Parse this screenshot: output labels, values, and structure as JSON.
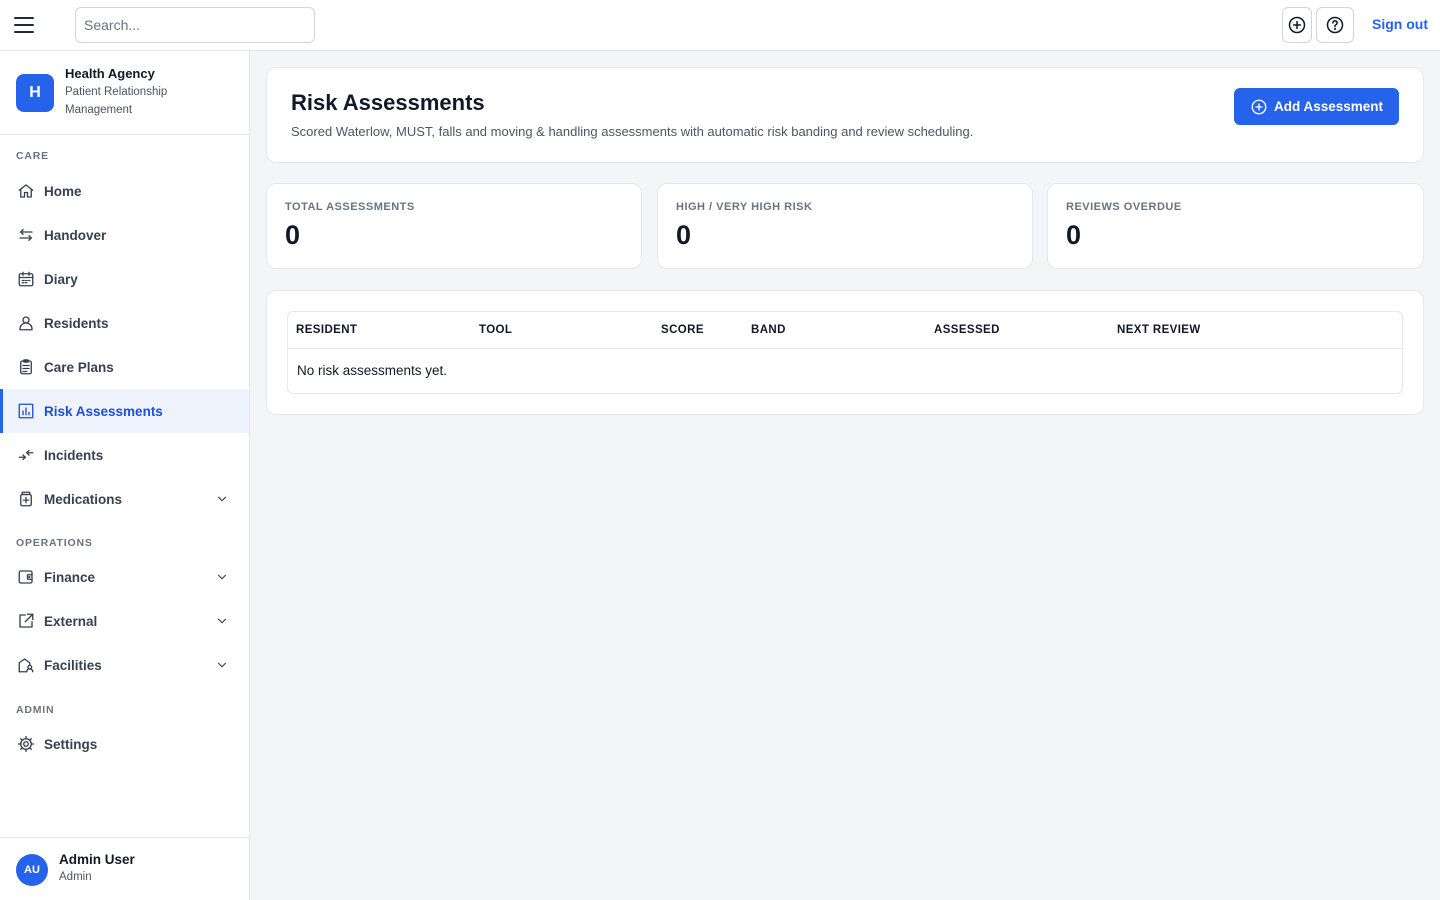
{
  "topbar": {
    "search_placeholder": "Search...",
    "sign_out": "Sign out"
  },
  "brand": {
    "logo_letter": "H",
    "name": "Health Agency",
    "subtitle": "Patient Relationship Management"
  },
  "sidebar": {
    "sections": {
      "care": "CARE",
      "operations": "OPERATIONS",
      "admin": "ADMIN"
    },
    "items": [
      {
        "label": "Home",
        "icon": "home-icon"
      },
      {
        "label": "Handover",
        "icon": "arrows-swap-icon"
      },
      {
        "label": "Diary",
        "icon": "calendar-icon"
      },
      {
        "label": "Residents",
        "icon": "person-icon"
      },
      {
        "label": "Care Plans",
        "icon": "clipboard-icon"
      },
      {
        "label": "Risk Assessments",
        "icon": "bar-chart-icon",
        "active": true
      },
      {
        "label": "Incidents",
        "icon": "arrows-converge-icon"
      },
      {
        "label": "Medications",
        "icon": "medicine-icon",
        "expandable": true
      },
      {
        "label": "Finance",
        "icon": "wallet-icon",
        "expandable": true
      },
      {
        "label": "External",
        "icon": "external-link-icon",
        "expandable": true
      },
      {
        "label": "Facilities",
        "icon": "building-icon",
        "expandable": true
      },
      {
        "label": "Settings",
        "icon": "gear-icon"
      }
    ]
  },
  "user": {
    "initials": "AU",
    "name": "Admin User",
    "role": "Admin"
  },
  "page": {
    "title": "Risk Assessments",
    "description": "Scored Waterlow, MUST, falls and moving & handling assessments with automatic risk banding and review scheduling.",
    "add_button": "Add Assessment"
  },
  "stats": [
    {
      "label": "TOTAL ASSESSMENTS",
      "value": "0"
    },
    {
      "label": "HIGH / VERY HIGH RISK",
      "value": "0"
    },
    {
      "label": "REVIEWS OVERDUE",
      "value": "0"
    }
  ],
  "table": {
    "columns": [
      "RESIDENT",
      "TOOL",
      "SCORE",
      "BAND",
      "ASSESSED",
      "NEXT REVIEW"
    ],
    "empty_message": "No risk assessments yet."
  },
  "colors": {
    "accent": "#2563eb",
    "active_bg": "#eef3fd",
    "page_bg": "#f4f5f7"
  }
}
